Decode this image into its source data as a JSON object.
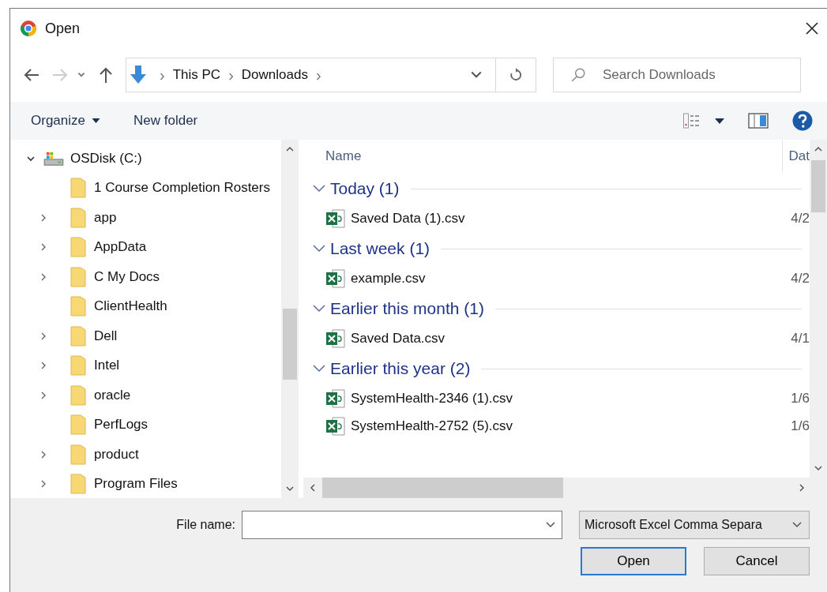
{
  "window": {
    "title": "Open"
  },
  "address": {
    "crumbs": [
      "This PC",
      "Downloads"
    ],
    "separator": "›"
  },
  "search": {
    "placeholder": "Search Downloads"
  },
  "toolbar": {
    "organize": "Organize",
    "new_folder": "New folder"
  },
  "tree": [
    {
      "label": "OSDisk (C:)",
      "expanded": true,
      "children": [
        {
          "label": "1 Course Completion Rosters",
          "expandable": false
        },
        {
          "label": "app",
          "expandable": true
        },
        {
          "label": "AppData",
          "expandable": true
        },
        {
          "label": "C My Docs",
          "expandable": true
        },
        {
          "label": "ClientHealth",
          "expandable": false
        },
        {
          "label": "Dell",
          "expandable": true
        },
        {
          "label": "Intel",
          "expandable": true
        },
        {
          "label": "oracle",
          "expandable": true
        },
        {
          "label": "PerfLogs",
          "expandable": false
        },
        {
          "label": "product",
          "expandable": true
        },
        {
          "label": "Program Files",
          "expandable": true
        }
      ]
    }
  ],
  "columns": [
    "Name",
    "Dat"
  ],
  "groups": [
    {
      "label": "Today (1)",
      "expanded": true,
      "files": [
        {
          "name": "Saved Data (1).csv",
          "date": "4/2"
        }
      ]
    },
    {
      "label": "Last week (1)",
      "expanded": true,
      "files": [
        {
          "name": "example.csv",
          "date": "4/2"
        }
      ]
    },
    {
      "label": "Earlier this month (1)",
      "expanded": true,
      "files": [
        {
          "name": "Saved Data.csv",
          "date": "4/1"
        }
      ]
    },
    {
      "label": "Earlier this year (2)",
      "expanded": true,
      "files": [
        {
          "name": "SystemHealth-2346 (1).csv",
          "date": "1/6"
        },
        {
          "name": "SystemHealth-2752 (5).csv",
          "date": "1/6"
        }
      ]
    }
  ],
  "file_name": {
    "label": "File name:"
  },
  "file_type": {
    "value": "Microsoft Excel Comma Separa"
  },
  "buttons": [
    {
      "label": "Open",
      "default": true
    },
    {
      "label": "Cancel",
      "default": false
    }
  ]
}
